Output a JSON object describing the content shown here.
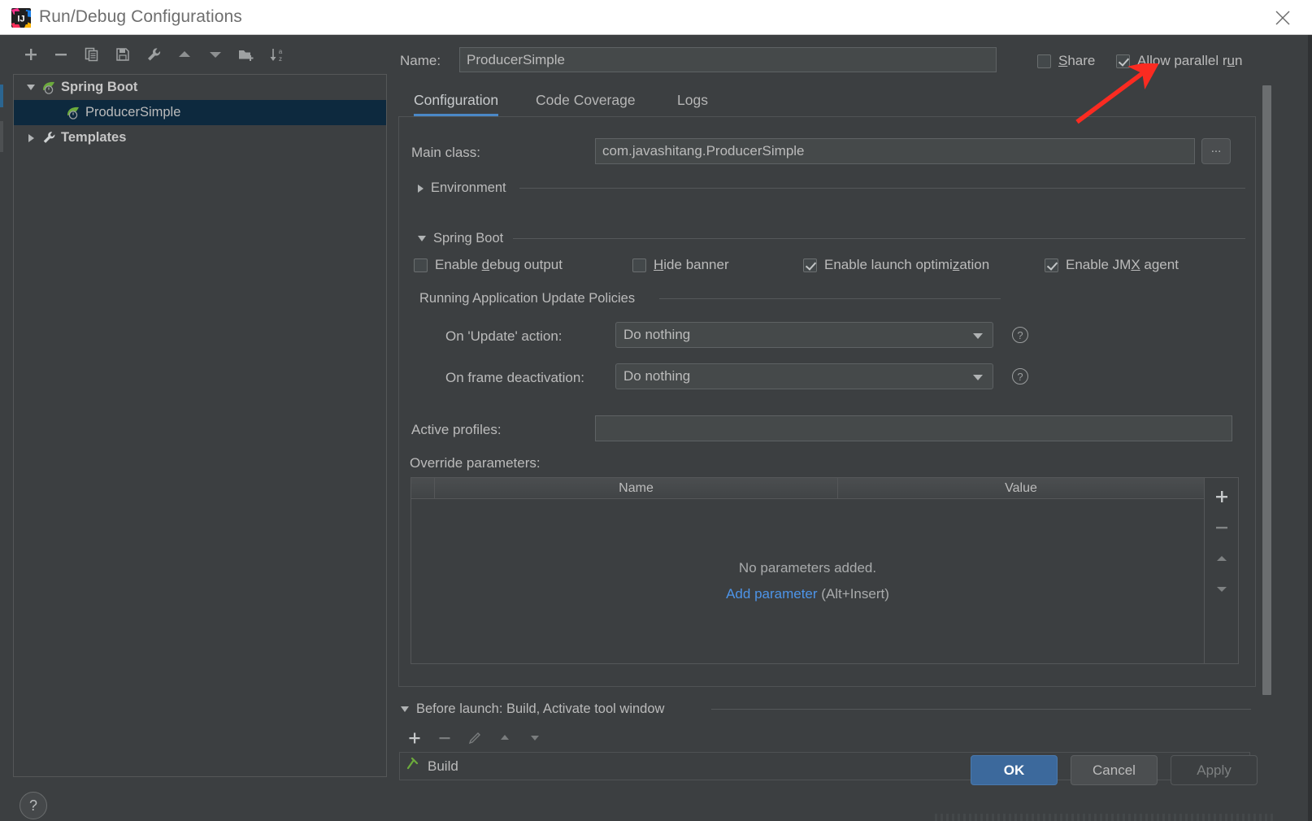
{
  "window": {
    "title": "Run/Debug Configurations",
    "app_icon": "intellij-idea-logo",
    "close_icon": "close-icon"
  },
  "left_panel": {
    "toolbar": [
      {
        "name": "add-configuration-button",
        "icon": "plus-icon"
      },
      {
        "name": "remove-configuration-button",
        "icon": "minus-icon"
      },
      {
        "name": "copy-configuration-button",
        "icon": "copy-icon"
      },
      {
        "name": "save-configuration-button",
        "icon": "save-icon"
      },
      {
        "name": "edit-templates-button",
        "icon": "wrench-icon"
      },
      {
        "name": "move-up-button",
        "icon": "triangle-up-icon"
      },
      {
        "name": "move-down-button",
        "icon": "triangle-down-icon"
      },
      {
        "name": "new-folder-button",
        "icon": "folder-add-icon"
      },
      {
        "name": "sort-configurations-button",
        "icon": "sort-az-icon"
      }
    ],
    "tree": [
      {
        "label": "Spring Boot",
        "level": 0,
        "expanded": true,
        "icon": "spring-boot-icon",
        "selected": false,
        "bold": true
      },
      {
        "label": "ProducerSimple",
        "level": 1,
        "expanded": null,
        "icon": "spring-boot-icon",
        "selected": true,
        "bold": false
      },
      {
        "label": "Templates",
        "level": 0,
        "expanded": false,
        "icon": "wrench-icon",
        "selected": false,
        "bold": true
      }
    ],
    "help_button": "?"
  },
  "header": {
    "name_label": "Name:",
    "name_value": "ProducerSimple",
    "share": {
      "label": "Share",
      "mnemonic": "S",
      "checked": false
    },
    "parallel": {
      "label_before": "Allow parallel r",
      "mnemonic": "u",
      "label_after": "n",
      "checked": true
    }
  },
  "tabs": [
    {
      "label": "Configuration",
      "active": true
    },
    {
      "label": "Code Coverage",
      "active": false
    },
    {
      "label": "Logs",
      "active": false
    }
  ],
  "configuration": {
    "main_class": {
      "label": "Main class:",
      "value": "com.javashitang.ProducerSimple",
      "browse_label": "..."
    },
    "environment_section": {
      "label": "Environment",
      "expanded": false
    },
    "spring_boot_section": {
      "label": "Spring Boot",
      "expanded": true,
      "checkboxes": [
        {
          "name": "enable-debug-output",
          "label_before": "Enable ",
          "mnemonic": "d",
          "label_after": "ebug output",
          "checked": false
        },
        {
          "name": "hide-banner",
          "label_before": "",
          "mnemonic": "H",
          "label_after": "ide banner",
          "checked": false
        },
        {
          "name": "enable-launch-optimization",
          "label_before": "Enable launch optimi",
          "mnemonic": "z",
          "label_after": "ation",
          "checked": true
        },
        {
          "name": "enable-jmx-agent",
          "label_before": "Enable JM",
          "mnemonic": "X",
          "label_after": " agent",
          "checked": true
        }
      ]
    },
    "update_policies": {
      "group_label": "Running Application Update Policies",
      "update_action": {
        "label": "On 'Update' action:",
        "value": "Do nothing",
        "help": "?"
      },
      "frame_deactivation": {
        "label": "On frame deactivation:",
        "value": "Do nothing",
        "help": "?"
      }
    },
    "active_profiles": {
      "label": "Active profiles:",
      "value": "",
      "placeholder": ""
    },
    "override_parameters": {
      "label": "Override parameters:",
      "columns": [
        "",
        "Name",
        "Value"
      ],
      "rows": [],
      "empty_text": "No parameters added.",
      "add_link": "Add parameter",
      "add_shortcut": "(Alt+Insert)",
      "side_buttons": [
        {
          "name": "add-parameter-button",
          "icon": "plus-icon"
        },
        {
          "name": "remove-parameter-button",
          "icon": "minus-icon"
        },
        {
          "name": "move-parameter-up-button",
          "icon": "triangle-up-icon"
        },
        {
          "name": "move-parameter-down-button",
          "icon": "triangle-down-icon"
        }
      ]
    }
  },
  "before_launch": {
    "header": "Before launch: Build, Activate tool window",
    "expanded": true,
    "toolbar": [
      {
        "name": "add-task-button",
        "icon": "plus-icon"
      },
      {
        "name": "remove-task-button",
        "icon": "minus-icon"
      },
      {
        "name": "edit-task-button",
        "icon": "pencil-icon"
      },
      {
        "name": "move-task-up-button",
        "icon": "triangle-up-icon"
      },
      {
        "name": "move-task-down-button",
        "icon": "triangle-down-icon"
      }
    ],
    "tasks": [
      {
        "label": "Build",
        "icon": "build-hammer-icon"
      }
    ]
  },
  "footer": {
    "ok": "OK",
    "cancel": "Cancel",
    "apply": "Apply"
  },
  "annotation": {
    "type": "red-arrow",
    "color": "#fb2b21",
    "points_at": "Allow parallel run checkbox"
  },
  "colors": {
    "dialog_background": "#3c3f41",
    "titlebar_background": "#ffffff",
    "field_background": "#45494a",
    "border": "#5e6264",
    "text": "#bbbbbb",
    "accent_blue": "#4a88c7",
    "link_blue": "#4d94e8",
    "selection_blue": "#0d293e",
    "ok_button": "#3c699c",
    "spring_green": "#6cab3c",
    "annotation_red": "#fb2b21"
  }
}
